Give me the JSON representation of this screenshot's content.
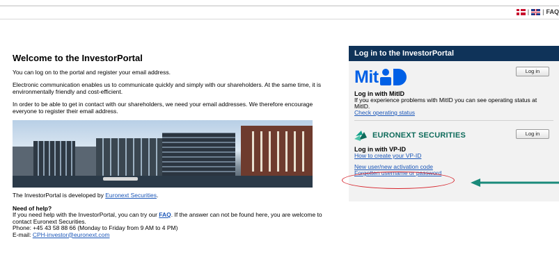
{
  "topbar": {
    "faq_label": "FAQ",
    "separator": "|"
  },
  "left": {
    "title": "Welcome to the InvestorPortal",
    "paragraphs": [
      "You can log on to the portal and register your email address.",
      "Electronic communication enables us to communicate quickly and simply with our shareholders. At the same time, it is environmentally friendly and cost-efficient.",
      "In order to be able to get in contact with our shareholders, we need your email addresses. We therefore encourage everyone to register their email address."
    ],
    "developed_prefix": "The InvestorPortal is developed by ",
    "developed_link": "Euronext Securities",
    "developed_suffix": ".",
    "help_title": "Need of help?",
    "help_line1_prefix": "If you need help with the InvestorPortal, you can try our ",
    "help_faq_link": "FAQ",
    "help_line1_suffix": ". If the answer can not be found here, you are welcome to contact Euronext Securities.",
    "phone": "Phone: +45 43 58 88 66 (Monday to Friday from 9 AM to 4 PM)",
    "email_label": "E-mail: ",
    "email_link": "CPH-investor@euronext.com"
  },
  "panel": {
    "title": "Log in to the InvestorPortal",
    "mitid": {
      "logo_text": "Mit",
      "login_button": "Log in",
      "heading": "Log in with MitID",
      "text": "If you experience problems with MitID you can see operating status at MitID.",
      "status_link": "Check operating status"
    },
    "vpid": {
      "logo_text": "EURONEXT SECURITIES",
      "login_button": "Log in",
      "heading": "Log in with VP-ID",
      "create_link": "How to create your VP-ID",
      "new_user_link": "New user/new activation code",
      "forgotten_link": "Forgotten username or password"
    }
  },
  "colors": {
    "panel_header": "#0f3359",
    "link": "#1a56b8",
    "mitid_blue": "#0060e6",
    "highlight_ring": "#d6222a",
    "arrow": "#1a8a7a"
  }
}
